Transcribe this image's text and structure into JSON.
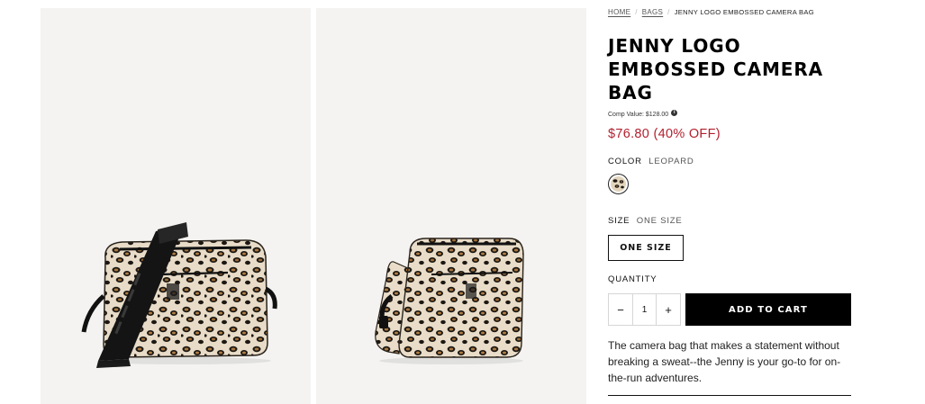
{
  "gallery": {
    "images": [
      {
        "alt": "Jenny Logo Embossed Camera Bag leopard, front view with strap"
      },
      {
        "alt": "Jenny Logo Embossed Camera Bag leopard, angled view"
      }
    ]
  },
  "breadcrumb": {
    "home": "HOME",
    "bags": "BAGS",
    "current": "JENNY LOGO EMBOSSED CAMERA BAG",
    "separator": "/"
  },
  "product": {
    "title": "JENNY LOGO EMBOSSED CAMERA BAG",
    "comp_value": "Comp Value: $128.00",
    "info_icon": "i",
    "price": "$76.80 (40% OFF)",
    "price_color": "#b21f2d"
  },
  "options": {
    "color_label": "COLOR",
    "color_value": "LEOPARD",
    "size_label": "SIZE",
    "size_value": "ONE SIZE",
    "size_button": "ONE SIZE",
    "swatch_icon": "leopard-swatch"
  },
  "purchase": {
    "quantity_label": "QUANTITY",
    "minus": "−",
    "quantity": "1",
    "plus": "+",
    "add_to_cart": "ADD TO CART"
  },
  "description": "The camera bag that makes a statement without breaking a sweat--the Jenny is your go-to for on-the-run adventures."
}
